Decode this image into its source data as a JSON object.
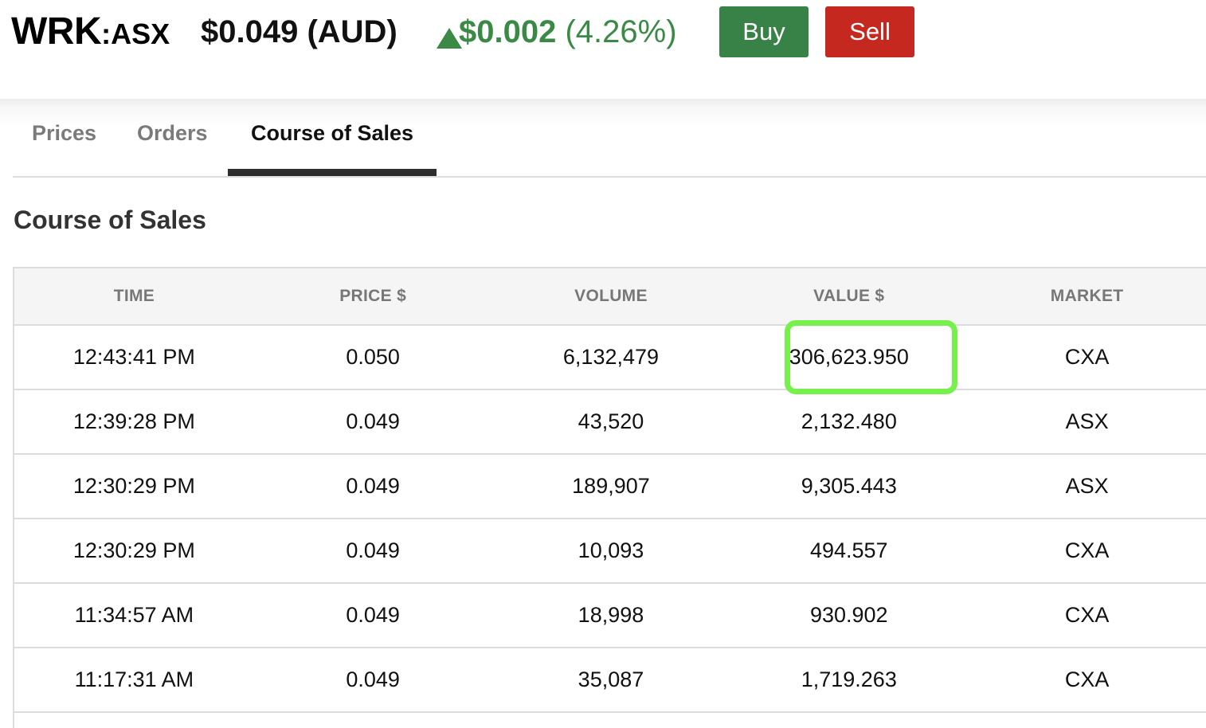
{
  "header": {
    "symbol": "WRK",
    "exchange": ":ASX",
    "price": "$0.049 (AUD)",
    "change_amount": "$0.002",
    "change_percent": "(4.26%)",
    "change_direction": "up-triangle-icon",
    "buy_label": "Buy",
    "sell_label": "Sell"
  },
  "tabs": [
    {
      "label": "Prices",
      "active": false
    },
    {
      "label": "Orders",
      "active": false
    },
    {
      "label": "Course of Sales",
      "active": true
    }
  ],
  "section_title": "Course of Sales",
  "table": {
    "columns": [
      "TIME",
      "PRICE $",
      "VOLUME",
      "VALUE $",
      "MARKET"
    ],
    "rows": [
      [
        "12:43:41 PM",
        "0.050",
        "6,132,479",
        "306,623.950",
        "CXA"
      ],
      [
        "12:39:28 PM",
        "0.049",
        "43,520",
        "2,132.480",
        "ASX"
      ],
      [
        "12:30:29 PM",
        "0.049",
        "189,907",
        "9,305.443",
        "ASX"
      ],
      [
        "12:30:29 PM",
        "0.049",
        "10,093",
        "494.557",
        "CXA"
      ],
      [
        "11:34:57 AM",
        "0.049",
        "18,998",
        "930.902",
        "CXA"
      ],
      [
        "11:17:31 AM",
        "0.049",
        "35,087",
        "1,719.263",
        "CXA"
      ]
    ],
    "highlighted_cell": {
      "row": 0,
      "column": 3
    }
  },
  "colors": {
    "positive": "#3a8a46",
    "buy": "#388247",
    "sell": "#c5281f",
    "highlight": "#76f04a"
  }
}
